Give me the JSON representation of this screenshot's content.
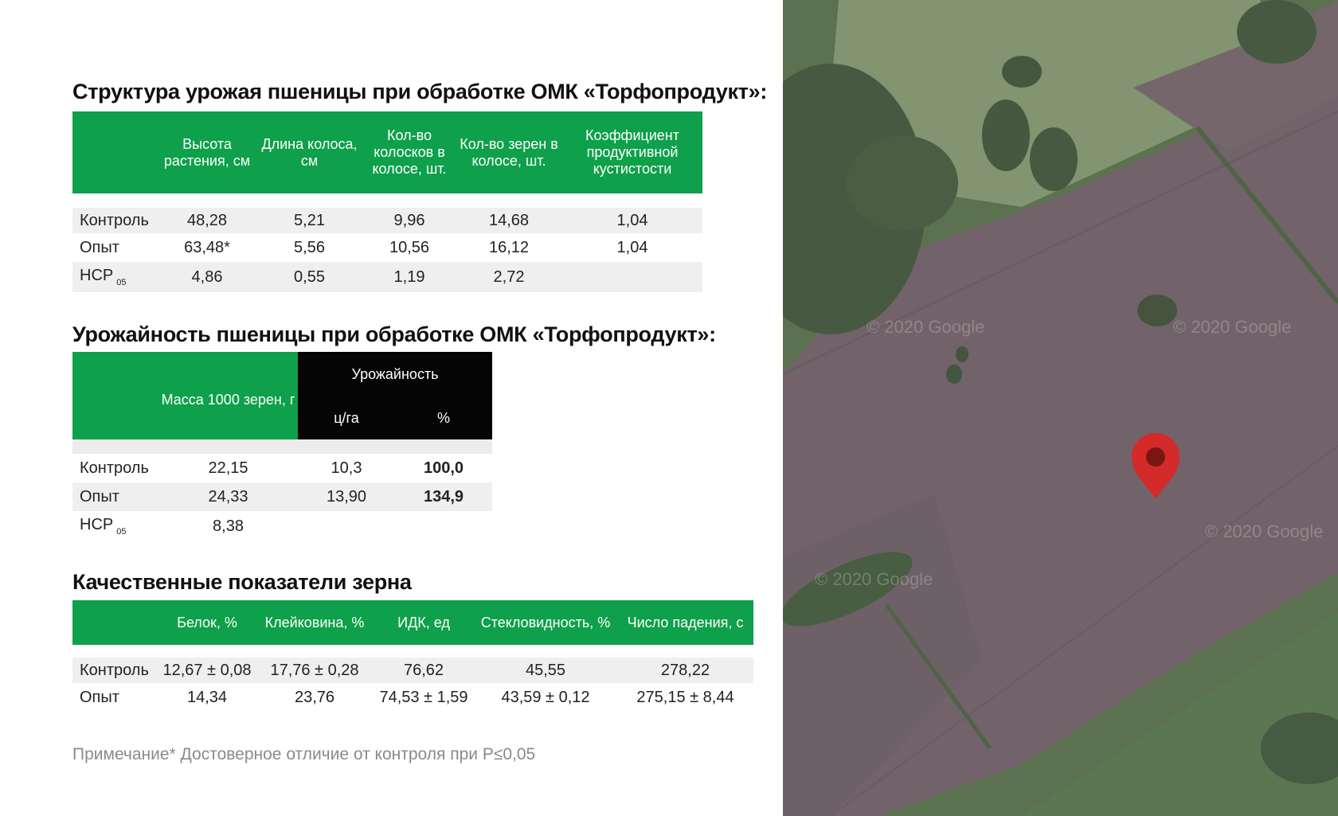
{
  "table1": {
    "title": "Структура урожая пшеницы при обработке ОМК «Торфопродукт»:",
    "headers": [
      "Высота растения, см",
      "Длина колоса, см",
      "Кол-во колосков в колосе, шт.",
      "Кол-во зерен в колосе, шт.",
      "Коэффициент продуктивной кустистости"
    ],
    "rows": [
      {
        "label": "Контроль",
        "values": [
          "48,28",
          "5,21",
          "9,96",
          "14,68",
          "1,04"
        ]
      },
      {
        "label": "Опыт",
        "values": [
          "63,48*",
          "5,56",
          "10,56",
          "16,12",
          "1,04"
        ]
      },
      {
        "label": "НСР",
        "sub": "05",
        "values": [
          "4,86",
          "0,55",
          "1,19",
          "2,72",
          ""
        ]
      }
    ]
  },
  "table2": {
    "title": "Урожайность пшеницы при обработке ОМК «Торфопродукт»:",
    "header_mass": "Масса 1000 зерен, г",
    "header_yield": "Урожайность",
    "header_units": [
      "ц/га",
      "%"
    ],
    "rows": [
      {
        "label": "Контроль",
        "values": [
          "22,15",
          "10,3",
          "100,0"
        ]
      },
      {
        "label": "Опыт",
        "values": [
          "24,33",
          "13,90",
          "134,9"
        ]
      },
      {
        "label": "НСР",
        "sub": "05",
        "values": [
          "8,38",
          "",
          ""
        ]
      }
    ]
  },
  "table3": {
    "title": "Качественные показатели зерна",
    "headers": [
      "Белок, %",
      "Клейковина, %",
      "ИДК, ед",
      "Стекловидность, %",
      "Число падения, с"
    ],
    "rows": [
      {
        "label": "Контроль",
        "values": [
          "12,67 ± 0,08",
          "17,76 ± 0,28",
          "76,62",
          "45,55",
          "278,22"
        ]
      },
      {
        "label": "Опыт",
        "values": [
          "14,34",
          "23,76",
          "74,53 ± 1,59",
          "43,59 ± 0,12",
          "275,15 ± 8,44"
        ]
      }
    ]
  },
  "note": "Примечание* Достоверное отличие от контроля при P≤0,05",
  "map": {
    "watermark": "© 2020 Google",
    "pin_color": "#d42a2a",
    "accent_green": "#0ea04a"
  }
}
